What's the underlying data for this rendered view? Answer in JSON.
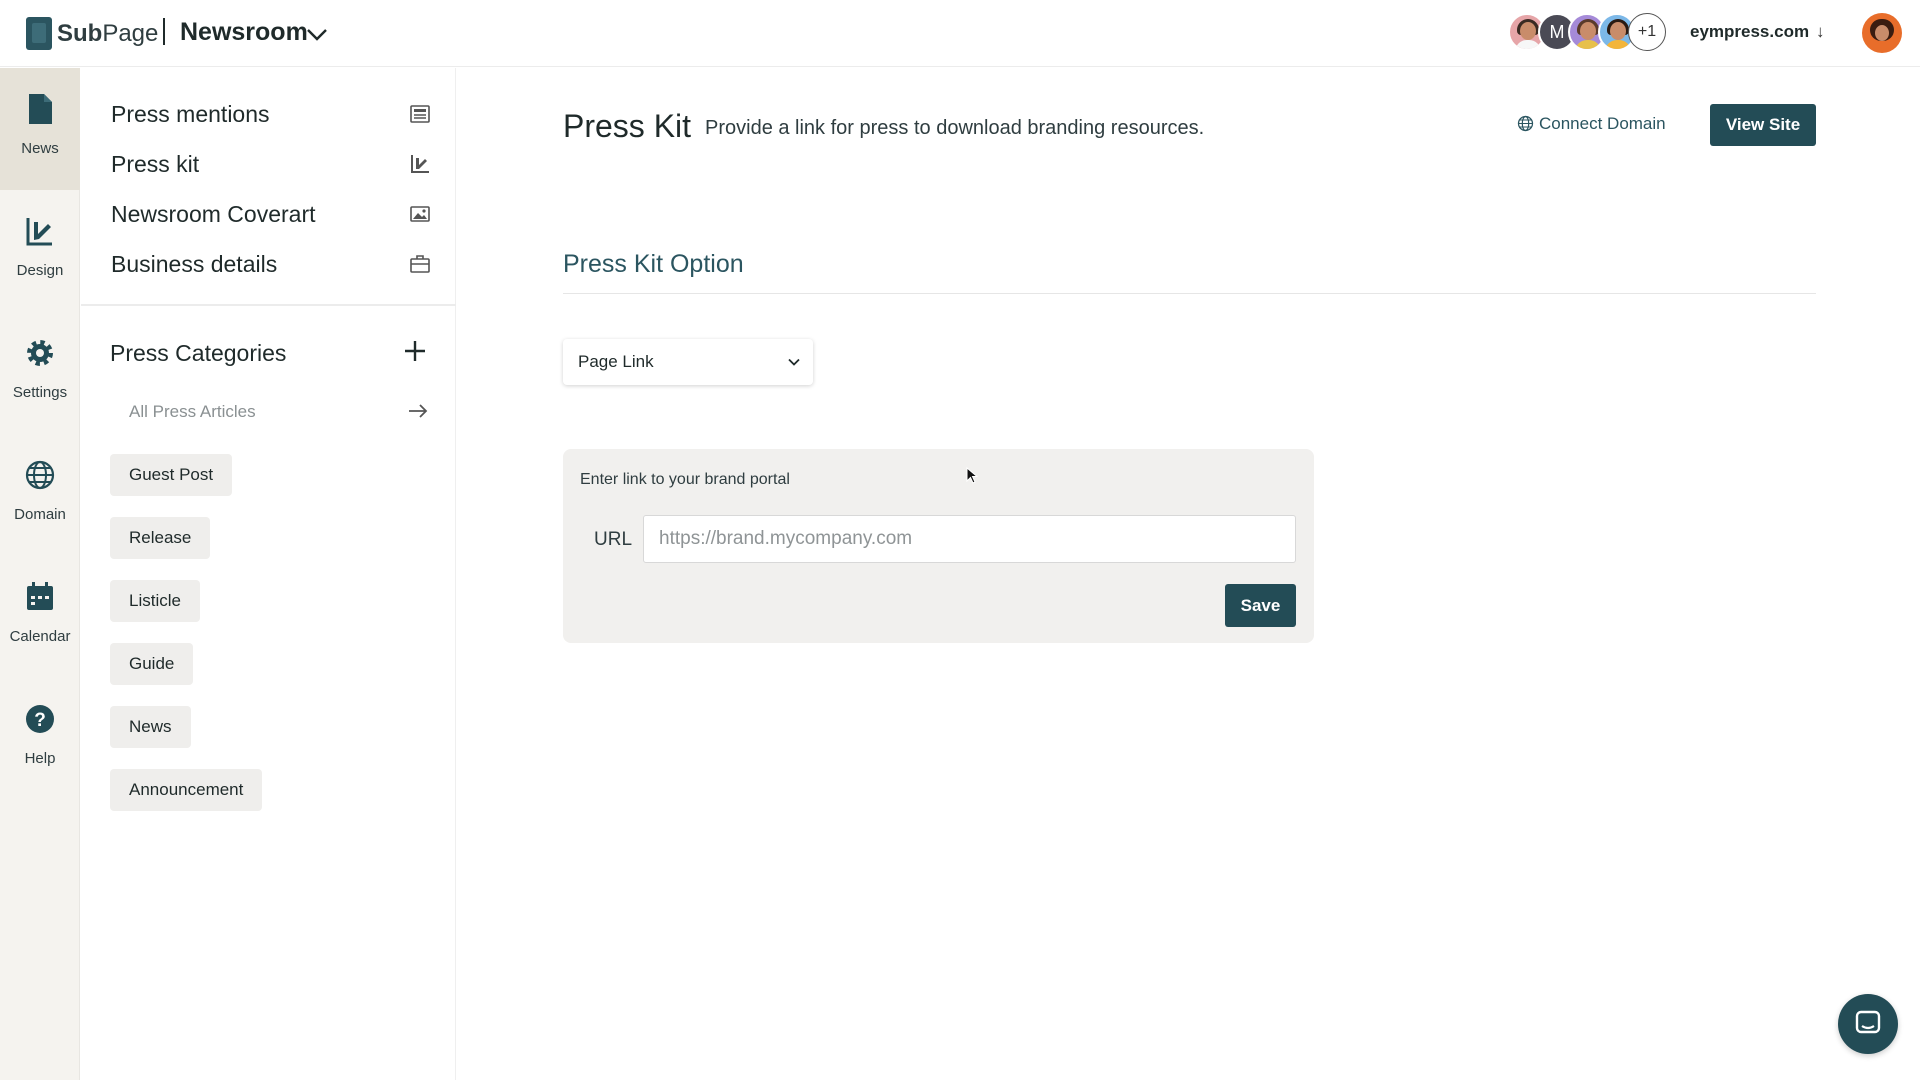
{
  "header": {
    "brand_prefix": "Sub",
    "brand_suffix": "Page",
    "workspace": "Newsroom",
    "collaborators_more": "+1",
    "collaborator_initial": "M",
    "domain": "eympress.com"
  },
  "rail": {
    "items": [
      {
        "label": "News",
        "icon": "document-icon"
      },
      {
        "label": "Design",
        "icon": "design-icon"
      },
      {
        "label": "Settings",
        "icon": "gear-icon"
      },
      {
        "label": "Domain",
        "icon": "globe-icon"
      },
      {
        "label": "Calendar",
        "icon": "calendar-icon"
      },
      {
        "label": "Help",
        "icon": "help-icon"
      }
    ],
    "active": "News"
  },
  "subnav": {
    "menu": [
      {
        "label": "Press mentions",
        "icon": "newspaper-icon"
      },
      {
        "label": "Press kit",
        "icon": "design-icon"
      },
      {
        "label": "Newsroom Coverart",
        "icon": "image-icon"
      },
      {
        "label": "Business details",
        "icon": "briefcase-icon"
      }
    ],
    "categories_title": "Press Categories",
    "all_articles": "All Press Articles",
    "categories": [
      "Guest Post",
      "Release",
      "Listicle",
      "Guide",
      "News",
      "Announcement"
    ]
  },
  "main": {
    "title": "Press Kit",
    "subtitle": "Provide a link for press to download branding resources.",
    "connect_domain": "Connect Domain",
    "view_site": "View Site",
    "section_title": "Press Kit Option",
    "option_selected": "Page Link",
    "panel_label": "Enter link to your brand portal",
    "url_label": "URL",
    "url_placeholder": "https://brand.mycompany.com",
    "url_value": "",
    "save_label": "Save"
  },
  "colors": {
    "accent": "#234c56",
    "rail_bg": "#f5f3ef",
    "rail_active": "#e6e2d8",
    "panel_bg": "#f1f0ee"
  }
}
